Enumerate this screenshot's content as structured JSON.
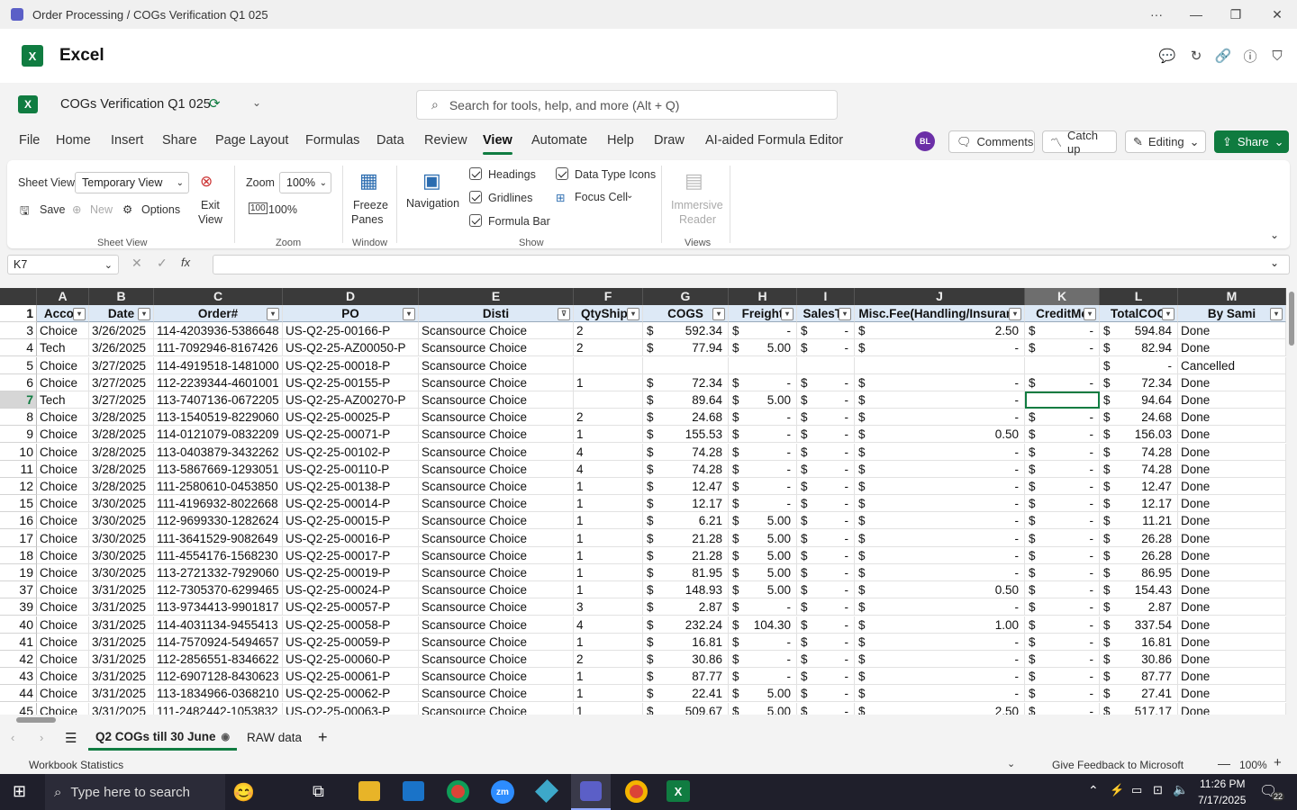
{
  "window": {
    "title": "Order Processing / COGs Verification Q1 025"
  },
  "app": {
    "name": "Excel"
  },
  "doc": {
    "name": "COGs Verification Q1 025"
  },
  "search": {
    "placeholder": "Search for tools, help, and more (Alt + Q)"
  },
  "tabs": [
    "File",
    "Home",
    "Insert",
    "Share",
    "Page Layout",
    "Formulas",
    "Data",
    "Review",
    "View",
    "Automate",
    "Help",
    "Draw",
    "AI-aided Formula Editor"
  ],
  "active_tab": "View",
  "header_buttons": {
    "avatar": "BL",
    "comments": "Comments",
    "catchup": "Catch up",
    "editing": "Editing",
    "share": "Share"
  },
  "ribbon": {
    "sheet_view_label": "Sheet View",
    "sheet_view_value": "Temporary View",
    "exit_view": [
      "Exit",
      "View"
    ],
    "save": "Save",
    "new": "New",
    "options": "Options",
    "group_sheet_view": "Sheet View",
    "zoom_label": "Zoom",
    "zoom_value": "100%",
    "zoom_100": "100%",
    "group_zoom": "Zoom",
    "freeze": [
      "Freeze",
      "Panes"
    ],
    "group_window": "Window",
    "navigation": "Navigation",
    "headings": "Headings",
    "gridlines": "Gridlines",
    "formula_bar": "Formula Bar",
    "data_type_icons": "Data Type Icons",
    "focus_cell": "Focus Cell",
    "group_show": "Show",
    "immersive": [
      "Immersive",
      "Reader"
    ],
    "group_views": "Views"
  },
  "namebox": "K7",
  "columns": [
    "A",
    "B",
    "C",
    "D",
    "E",
    "F",
    "G",
    "H",
    "I",
    "J",
    "K",
    "L",
    "M"
  ],
  "selected_column": "K",
  "headers": [
    "Accou",
    "Date",
    "Order#",
    "PO",
    "Disti",
    "QtyShipp",
    "COGS",
    "Freight",
    "SalesTa",
    "Misc.Fee(Handling/Insuranc",
    "CreditMe",
    "TotalCOG",
    "By Sami"
  ],
  "rows": [
    {
      "n": "3",
      "a": "Choice",
      "b": "3/26/2025",
      "c": "114-4203936-5386648",
      "d": "US-Q2-25-00166-P",
      "e": "Scansource Choice",
      "f": "2",
      "g": "592.34",
      "h": "-",
      "i": "-",
      "j": "2.50",
      "k": "-",
      "l": "594.84",
      "m": "Done"
    },
    {
      "n": "4",
      "a": "Tech",
      "b": "3/26/2025",
      "c": "111-7092946-8167426",
      "d": "US-Q2-25-AZ00050-P",
      "e": "Scansource Choice",
      "f": "2",
      "g": "77.94",
      "h": "5.00",
      "i": "-",
      "j": "-",
      "k": "-",
      "l": "82.94",
      "m": "Done"
    },
    {
      "n": "5",
      "a": "Choice",
      "b": "3/27/2025",
      "c": "114-4919518-1481000",
      "d": "US-Q2-25-00018-P",
      "e": "Scansource Choice",
      "f": "",
      "g": "",
      "h": "",
      "i": "",
      "j": "",
      "k": "",
      "l": "-",
      "m": "Cancelled"
    },
    {
      "n": "6",
      "a": "Choice",
      "b": "3/27/2025",
      "c": "112-2239344-4601001",
      "d": "US-Q2-25-00155-P",
      "e": "Scansource Choice",
      "f": "1",
      "g": "72.34",
      "h": "-",
      "i": "-",
      "j": "-",
      "k": "-",
      "l": "72.34",
      "m": "Done"
    },
    {
      "n": "7",
      "a": "Tech",
      "b": "3/27/2025",
      "c": "113-7407136-0672205",
      "d": "US-Q2-25-AZ00270-P",
      "e": "Scansource Choice",
      "f": "",
      "g": "89.64",
      "h": "5.00",
      "i": "-",
      "j": "-",
      "k": "",
      "l": "94.64",
      "m": "Done"
    },
    {
      "n": "8",
      "a": "Choice",
      "b": "3/28/2025",
      "c": "113-1540519-8229060",
      "d": "US-Q2-25-00025-P",
      "e": "Scansource Choice",
      "f": "2",
      "g": "24.68",
      "h": "-",
      "i": "-",
      "j": "-",
      "k": "-",
      "l": "24.68",
      "m": "Done"
    },
    {
      "n": "9",
      "a": "Choice",
      "b": "3/28/2025",
      "c": "114-0121079-0832209",
      "d": "US-Q2-25-00071-P",
      "e": "Scansource Choice",
      "f": "1",
      "g": "155.53",
      "h": "-",
      "i": "-",
      "j": "0.50",
      "k": "-",
      "l": "156.03",
      "m": "Done"
    },
    {
      "n": "10",
      "a": "Choice",
      "b": "3/28/2025",
      "c": "113-0403879-3432262",
      "d": "US-Q2-25-00102-P",
      "e": "Scansource Choice",
      "f": "4",
      "g": "74.28",
      "h": "-",
      "i": "-",
      "j": "-",
      "k": "-",
      "l": "74.28",
      "m": "Done"
    },
    {
      "n": "11",
      "a": "Choice",
      "b": "3/28/2025",
      "c": "113-5867669-1293051",
      "d": "US-Q2-25-00110-P",
      "e": "Scansource Choice",
      "f": "4",
      "g": "74.28",
      "h": "-",
      "i": "-",
      "j": "-",
      "k": "-",
      "l": "74.28",
      "m": "Done"
    },
    {
      "n": "12",
      "a": "Choice",
      "b": "3/28/2025",
      "c": "111-2580610-0453850",
      "d": "US-Q2-25-00138-P",
      "e": "Scansource Choice",
      "f": "1",
      "g": "12.47",
      "h": "-",
      "i": "-",
      "j": "-",
      "k": "-",
      "l": "12.47",
      "m": "Done"
    },
    {
      "n": "15",
      "a": "Choice",
      "b": "3/30/2025",
      "c": "111-4196932-8022668",
      "d": "US-Q2-25-00014-P",
      "e": "Scansource Choice",
      "f": "1",
      "g": "12.17",
      "h": "-",
      "i": "-",
      "j": "-",
      "k": "-",
      "l": "12.17",
      "m": "Done"
    },
    {
      "n": "16",
      "a": "Choice",
      "b": "3/30/2025",
      "c": "112-9699330-1282624",
      "d": "US-Q2-25-00015-P",
      "e": "Scansource Choice",
      "f": "1",
      "g": "6.21",
      "h": "5.00",
      "i": "-",
      "j": "-",
      "k": "-",
      "l": "11.21",
      "m": "Done"
    },
    {
      "n": "17",
      "a": "Choice",
      "b": "3/30/2025",
      "c": "111-3641529-9082649",
      "d": "US-Q2-25-00016-P",
      "e": "Scansource Choice",
      "f": "1",
      "g": "21.28",
      "h": "5.00",
      "i": "-",
      "j": "-",
      "k": "-",
      "l": "26.28",
      "m": "Done"
    },
    {
      "n": "18",
      "a": "Choice",
      "b": "3/30/2025",
      "c": "111-4554176-1568230",
      "d": "US-Q2-25-00017-P",
      "e": "Scansource Choice",
      "f": "1",
      "g": "21.28",
      "h": "5.00",
      "i": "-",
      "j": "-",
      "k": "-",
      "l": "26.28",
      "m": "Done"
    },
    {
      "n": "19",
      "a": "Choice",
      "b": "3/30/2025",
      "c": "113-2721332-7929060",
      "d": "US-Q2-25-00019-P",
      "e": "Scansource Choice",
      "f": "1",
      "g": "81.95",
      "h": "5.00",
      "i": "-",
      "j": "-",
      "k": "-",
      "l": "86.95",
      "m": "Done"
    },
    {
      "n": "37",
      "a": "Choice",
      "b": "3/31/2025",
      "c": "112-7305370-6299465",
      "d": "US-Q2-25-00024-P",
      "e": "Scansource Choice",
      "f": "1",
      "g": "148.93",
      "h": "5.00",
      "i": "-",
      "j": "0.50",
      "k": "-",
      "l": "154.43",
      "m": "Done"
    },
    {
      "n": "39",
      "a": "Choice",
      "b": "3/31/2025",
      "c": "113-9734413-9901817",
      "d": "US-Q2-25-00057-P",
      "e": "Scansource Choice",
      "f": "3",
      "g": "2.87",
      "h": "-",
      "i": "-",
      "j": "-",
      "k": "-",
      "l": "2.87",
      "m": "Done"
    },
    {
      "n": "40",
      "a": "Choice",
      "b": "3/31/2025",
      "c": "114-4031134-9455413",
      "d": "US-Q2-25-00058-P",
      "e": "Scansource Choice",
      "f": "4",
      "g": "232.24",
      "h": "104.30",
      "i": "-",
      "j": "1.00",
      "k": "-",
      "l": "337.54",
      "m": "Done"
    },
    {
      "n": "41",
      "a": "Choice",
      "b": "3/31/2025",
      "c": "114-7570924-5494657",
      "d": "US-Q2-25-00059-P",
      "e": "Scansource Choice",
      "f": "1",
      "g": "16.81",
      "h": "-",
      "i": "-",
      "j": "-",
      "k": "-",
      "l": "16.81",
      "m": "Done"
    },
    {
      "n": "42",
      "a": "Choice",
      "b": "3/31/2025",
      "c": "112-2856551-8346622",
      "d": "US-Q2-25-00060-P",
      "e": "Scansource Choice",
      "f": "2",
      "g": "30.86",
      "h": "-",
      "i": "-",
      "j": "-",
      "k": "-",
      "l": "30.86",
      "m": "Done"
    },
    {
      "n": "43",
      "a": "Choice",
      "b": "3/31/2025",
      "c": "112-6907128-8430623",
      "d": "US-Q2-25-00061-P",
      "e": "Scansource Choice",
      "f": "1",
      "g": "87.77",
      "h": "-",
      "i": "-",
      "j": "-",
      "k": "-",
      "l": "87.77",
      "m": "Done"
    },
    {
      "n": "44",
      "a": "Choice",
      "b": "3/31/2025",
      "c": "113-1834966-0368210",
      "d": "US-Q2-25-00062-P",
      "e": "Scansource Choice",
      "f": "1",
      "g": "22.41",
      "h": "5.00",
      "i": "-",
      "j": "-",
      "k": "-",
      "l": "27.41",
      "m": "Done"
    },
    {
      "n": "45",
      "a": "Choice",
      "b": "3/31/2025",
      "c": "111-2482442-1053832",
      "d": "US-Q2-25-00063-P",
      "e": "Scansource Choice",
      "f": "1",
      "g": "509.67",
      "h": "5.00",
      "i": "-",
      "j": "2.50",
      "k": "-",
      "l": "517.17",
      "m": "Done"
    }
  ],
  "sheet_tabs": [
    "Q2 COGs till 30 June",
    "RAW data"
  ],
  "active_sheet": "Q2 COGs till 30 June",
  "status": {
    "left": "Workbook Statistics",
    "feedback": "Give Feedback to Microsoft",
    "zoom": "100%"
  },
  "taskbar": {
    "search_placeholder": "Type here to search",
    "time": "11:26 PM",
    "date": "7/17/2025",
    "notifications": "22"
  },
  "colors": {
    "accent": "#107c41",
    "share": "#0f7b3f",
    "avatar": "#6b2fa7",
    "taskbar": "#1f1f2b"
  }
}
